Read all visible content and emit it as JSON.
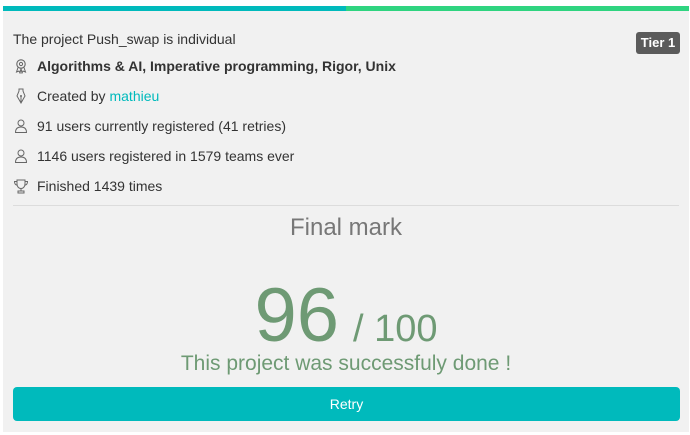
{
  "project": {
    "headline": "The project Push_swap is individual",
    "tier": "Tier 1",
    "skills": "Algorithms & AI, Imperative programming, Rigor, Unix",
    "created_by_label": "Created by",
    "creator": "mathieu",
    "current_users": "91 users currently registered (41 retries)",
    "total_users": "1146 users registered in 1579 teams ever",
    "finished": "Finished 1439 times"
  },
  "result": {
    "title": "Final mark",
    "score": "96",
    "separator": "/ 100",
    "message": "This project was successfuly done !",
    "retry_label": "Retry"
  },
  "colors": {
    "accent": "#00babc",
    "accent_secondary": "#2fd480",
    "success_text": "#6e9a74",
    "tier_badge": "#5b5b5b"
  },
  "icons": {
    "skills": "skills-badge-icon",
    "creator": "pen-nib-icon",
    "users_current": "user-icon",
    "users_total": "user-icon",
    "finished": "trophy-icon"
  }
}
